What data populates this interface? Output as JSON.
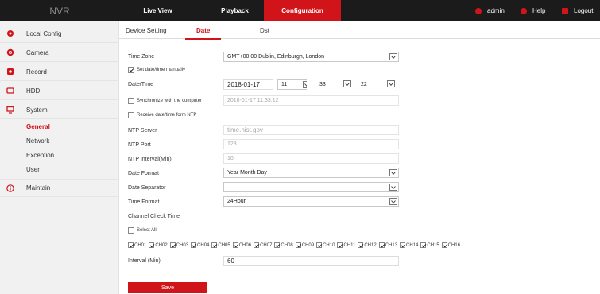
{
  "header": {
    "logo": "NVR",
    "tabs": [
      {
        "label": "Live View"
      },
      {
        "label": "Playback"
      },
      {
        "label": "Configuration"
      }
    ],
    "right": {
      "user": "admin",
      "help": "Help",
      "logout": "Logout"
    },
    "accent_color": "#d1141a"
  },
  "sidebar": {
    "items": [
      {
        "label": "Local Config",
        "icon": "gear-icon"
      },
      {
        "label": "Camera",
        "icon": "camera-icon"
      },
      {
        "label": "Record",
        "icon": "record-icon"
      },
      {
        "label": "HDD",
        "icon": "hdd-icon"
      },
      {
        "label": "System",
        "icon": "monitor-icon"
      },
      {
        "label": "Maintain",
        "icon": "info-icon"
      }
    ],
    "system_subitems": [
      "General",
      "Network",
      "Exception",
      "User"
    ]
  },
  "subtabs": [
    "Device Setting",
    "Date",
    "Dst"
  ],
  "form": {
    "time_zone": {
      "label": "Time Zone",
      "value": "GMT+00:00 Dublin, Edinburgh, London"
    },
    "set_manually": {
      "label": "Set date/time manually",
      "checked": true
    },
    "datetime": {
      "label": "Date/Time",
      "date": "2018-01-17",
      "hour": "11",
      "minute": "33",
      "second": "22"
    },
    "sync_computer": {
      "label": "Synchronize with the computer",
      "checked": false,
      "value": "2018-01-17 11:33:12"
    },
    "receive_ntp": {
      "label": "Receive date/time form NTP",
      "checked": false
    },
    "ntp_server": {
      "label": "NTP Server",
      "value": "time.nist.gov"
    },
    "ntp_port": {
      "label": "NTP Port",
      "value": "123"
    },
    "ntp_interval": {
      "label": "NTP Interval(Min)",
      "value": "10"
    },
    "date_format": {
      "label": "Date Format",
      "value": "Year Month Day"
    },
    "date_separator": {
      "label": "Date Separator",
      "value": ""
    },
    "time_format": {
      "label": "Time Format",
      "value": "24Hour"
    },
    "channel_check": {
      "label": "Channel Check Time"
    },
    "select_all": {
      "label": "Select All",
      "checked": false
    },
    "channels": [
      "CH01",
      "CH02",
      "CH03",
      "CH04",
      "CH05",
      "CH06",
      "CH07",
      "CH08",
      "CH09",
      "CH10",
      "CH11",
      "CH12",
      "CH13",
      "CH14",
      "CH15",
      "CH16"
    ],
    "interval": {
      "label": "Interval (Min)",
      "value": "60"
    },
    "save_label": "Save"
  }
}
